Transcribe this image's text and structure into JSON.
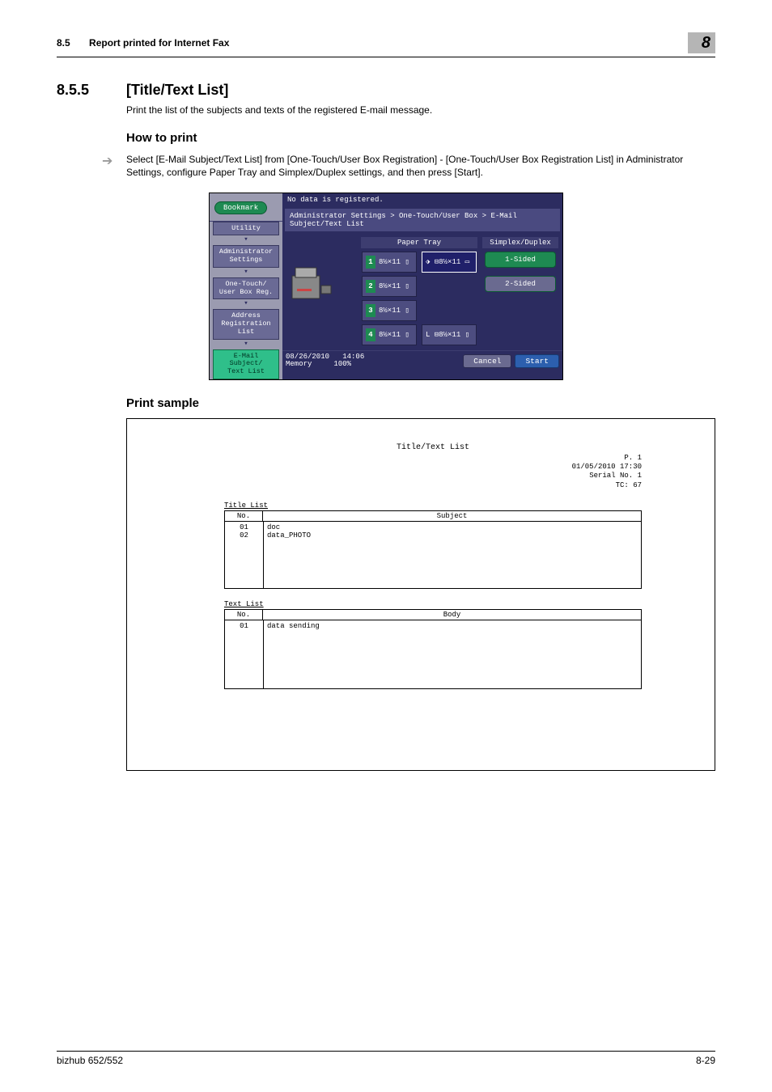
{
  "header": {
    "section_num": "8.5",
    "section_title": "Report printed for Internet Fax",
    "chapter_chip": "8"
  },
  "section": {
    "num": "8.5.5",
    "title": "[Title/Text List]"
  },
  "intro": "Print the list of the subjects and texts of the registered E-mail message.",
  "howto_heading": "How to print",
  "instruction": "Select [E-Mail Subject/Text List] from [One-Touch/User Box Registration] - [One-Touch/User Box Registration List] in Administrator Settings, configure Paper Tray and Simplex/Duplex settings, and then press [Start].",
  "panel": {
    "status": "No data is registered.",
    "bookmark": "Bookmark",
    "breadcrumb": "Administrator Settings > One-Touch/User Box > E-Mail Subject/Text List",
    "paper_tray_label": "Paper Tray",
    "duplex_label": "Simplex/Duplex",
    "trays": {
      "t1": "8½×11 ▯",
      "t1b": "⬗ ⊟8½×11 ▭",
      "t2": "8½×11 ▯",
      "t3": "8½×11 ▯",
      "t4": "8½×11 ▯",
      "t4b": "L ⊟8½×11 ▯"
    },
    "dup1": "1-Sided",
    "dup2": "2-Sided",
    "side": {
      "utility": "Utility",
      "admin": "Administrator\nSettings",
      "otub": "One-Touch/\nUser Box Reg.",
      "addr": "Address\nRegistration\nList",
      "current": "E-Mail Subject/\nText List"
    },
    "footer": {
      "date": "08/26/2010",
      "time": "14:06",
      "mem": "Memory",
      "mempct": "100%",
      "cancel": "Cancel",
      "start": "Start"
    }
  },
  "sample_heading": "Print sample",
  "sample": {
    "title": "Title/Text List",
    "meta": {
      "p": "P.  1",
      "dt": "01/05/2010 17:30",
      "serial": "Serial No.  1",
      "tc": "TC:        67"
    },
    "title_list_label": "Title List",
    "no_label": "No.",
    "subject_label": "Subject",
    "title_rows": [
      {
        "no": "01",
        "subj": "doc"
      },
      {
        "no": "02",
        "subj": "data_PHOTO"
      }
    ],
    "text_list_label": "Text List",
    "body_label": "Body",
    "text_rows": [
      {
        "no": "01",
        "body": "data sending"
      }
    ]
  },
  "footer": {
    "model": "bizhub 652/552",
    "page": "8-29"
  }
}
